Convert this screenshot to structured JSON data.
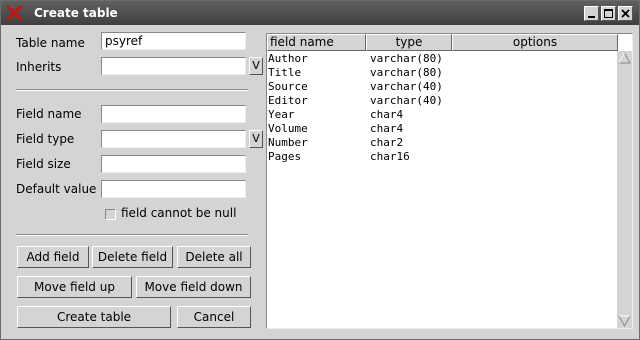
{
  "window": {
    "title": "Create table"
  },
  "form": {
    "table_name_label": "Table name",
    "table_name_value": "psyref",
    "inherits_label": "Inherits",
    "inherits_value": "",
    "dropdown_glyph": "V",
    "field_name_label": "Field name",
    "field_name_value": "",
    "field_type_label": "Field type",
    "field_type_value": "",
    "field_size_label": "Field size",
    "field_size_value": "",
    "default_value_label": "Default value",
    "default_value_value": "",
    "not_null_label": "field cannot be null",
    "not_null_checked": false
  },
  "buttons": {
    "add_field": "Add field",
    "delete_field": "Delete field",
    "delete_all": "Delete all",
    "move_up": "Move field up",
    "move_down": "Move field down",
    "create_table": "Create table",
    "cancel": "Cancel"
  },
  "fields_table": {
    "columns": [
      "field name",
      "type",
      "options"
    ],
    "rows": [
      {
        "name": "Author",
        "type": "varchar(80)",
        "options": ""
      },
      {
        "name": "Title",
        "type": "varchar(80)",
        "options": ""
      },
      {
        "name": "Source",
        "type": "varchar(40)",
        "options": ""
      },
      {
        "name": "Editor",
        "type": "varchar(40)",
        "options": ""
      },
      {
        "name": "Year",
        "type": "char4",
        "options": ""
      },
      {
        "name": "Volume",
        "type": "char4",
        "options": ""
      },
      {
        "name": "Number",
        "type": "char2",
        "options": ""
      },
      {
        "name": "Pages",
        "type": "char16",
        "options": ""
      }
    ]
  },
  "colors": {
    "titlebar": "#4a4a4a",
    "window_bg": "#d4d4d4",
    "close_icon": "#cc1111"
  }
}
